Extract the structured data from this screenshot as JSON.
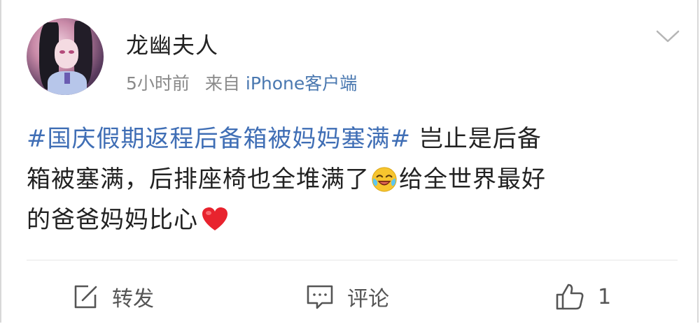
{
  "post": {
    "username": "龙幽夫人",
    "time": "5小时前",
    "source_prefix": "来自",
    "source_client": "iPhone客户端",
    "hashtag": "#国庆假期返程后备箱被妈妈塞满#",
    "text_line1": "岂止是后备",
    "text_line2": "箱被塞满，后排座椅也全堆满了",
    "text_line2b": "给全世界最好",
    "text_line3": "的爸爸妈妈比心",
    "emojis": [
      "laugh-cry-emoji",
      "heart-emoji"
    ]
  },
  "actions": {
    "repost_label": "转发",
    "comment_label": "评论",
    "like_count": "1"
  },
  "colors": {
    "hashtag": "#3f6eb5",
    "client": "#4a78b0",
    "meta": "#8a8a8a",
    "text": "#222222"
  }
}
